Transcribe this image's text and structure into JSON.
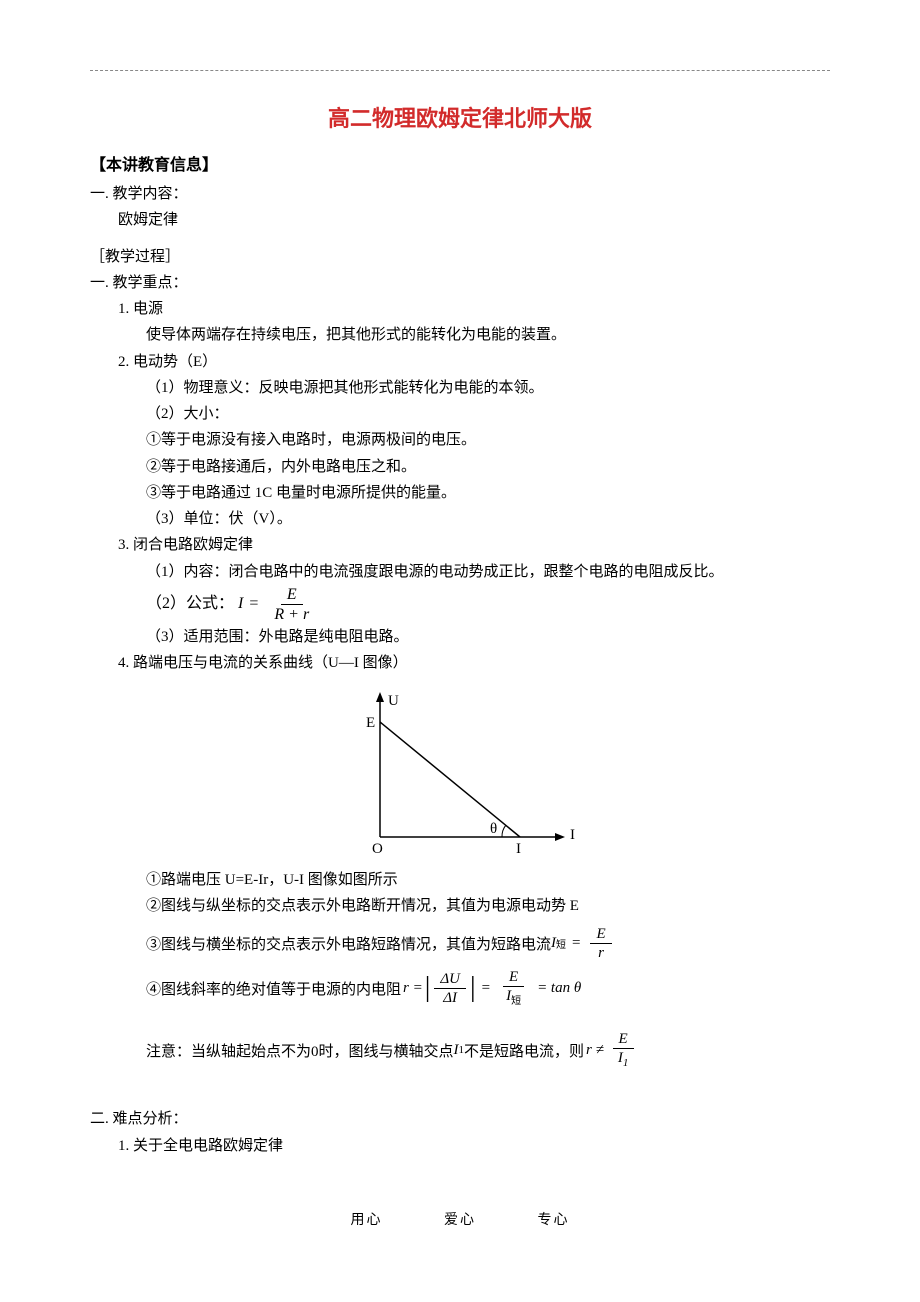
{
  "title": "高二物理欧姆定律北师大版",
  "section_info_header": "【本讲教育信息】",
  "teaching_content_label": "一. 教学内容：",
  "teaching_content_value": "欧姆定律",
  "teaching_process_label": "［教学过程］",
  "key_points_label": "一. 教学重点：",
  "kp1_title": "1. 电源",
  "kp1_body": "使导体两端存在持续电压，把其他形式的能转化为电能的装置。",
  "kp2_title": "2. 电动势（E）",
  "kp2_1": "（1）物理意义：反映电源把其他形式能转化为电能的本领。",
  "kp2_2": "（2）大小：",
  "kp2_2a": "①等于电源没有接入电路时，电源两极间的电压。",
  "kp2_2b": "②等于电路接通后，内外电路电压之和。",
  "kp2_2c": "③等于电路通过 1C 电量时电源所提供的能量。",
  "kp2_3": "（3）单位：伏（V）。",
  "kp3_title": "3. 闭合电路欧姆定律",
  "kp3_1": "（1）内容：闭合电路中的电流强度跟电源的电动势成正比，跟整个电路的电阻成反比。",
  "kp3_2_label": "（2）公式：",
  "kp3_2_I": "I",
  "kp3_2_eq": "=",
  "kp3_2_num": "E",
  "kp3_2_den": "R + r",
  "kp3_3": "（3）适用范围：外电路是纯电阻电路。",
  "kp4_title": "4. 路端电压与电流的关系曲线（U—I 图像）",
  "graph": {
    "y_label": "U",
    "x_label": "I",
    "origin": "O",
    "E_label": "E",
    "I_label": "I",
    "theta": "θ"
  },
  "kp4_a": "①路端电压 U=E-Ir，U-I 图像如图所示",
  "kp4_b": "②图线与纵坐标的交点表示外电路断开情况，其值为电源电动势 E",
  "kp4_c_text": "③图线与横坐标的交点表示外电路短路情况，其值为短路电流",
  "kp4_c_I": "I",
  "kp4_c_sub": "短",
  "kp4_c_eq": "=",
  "kp4_c_num": "E",
  "kp4_c_den": "r",
  "kp4_d_text": "④图线斜率的绝对值等于电源的内电阻",
  "kp4_d_r": "r =",
  "kp4_d_dU": "ΔU",
  "kp4_d_dI": "ΔI",
  "kp4_d_eq2": "=",
  "kp4_d_E": "E",
  "kp4_d_Iden": "I",
  "kp4_d_Iden_sub": "短",
  "kp4_d_tan": "= tan θ",
  "note_label": "注意：",
  "note_text": "当纵轴起始点不为0时，图线与横轴交点",
  "note_I1": "I",
  "note_I1_sub": "1",
  "note_text2": "不是短路电流，则",
  "note_r": "r ≠",
  "note_num": "E",
  "note_den_I": "I",
  "note_den_sub": "1",
  "difficulty_label": "二. 难点分析：",
  "difficulty_1": "1. 关于全电电路欧姆定律",
  "footer": {
    "a": "用心",
    "b": "爱心",
    "c": "专心"
  }
}
